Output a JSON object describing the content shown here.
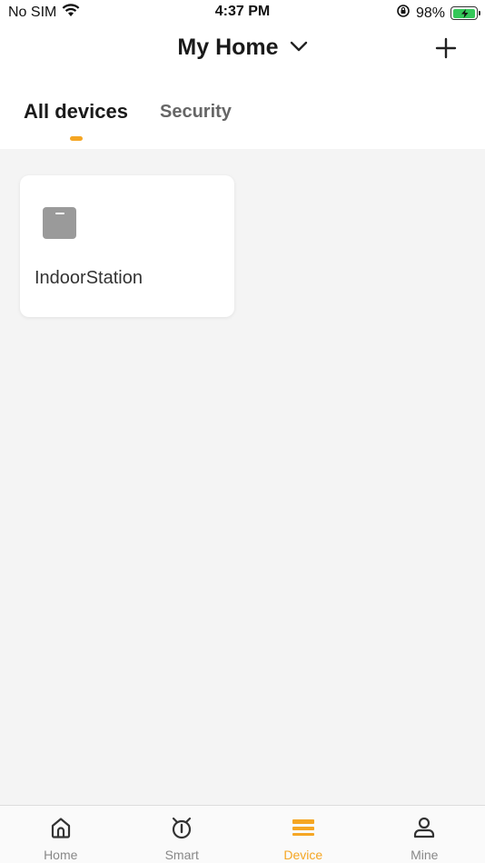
{
  "status_bar": {
    "carrier": "No SIM",
    "time": "4:37 PM",
    "battery_percent": "98%",
    "battery_level": 0.98
  },
  "header": {
    "home_name": "My Home"
  },
  "tabs": [
    {
      "label": "All devices",
      "active": true
    },
    {
      "label": "Security",
      "active": false
    }
  ],
  "devices": [
    {
      "name": "IndoorStation",
      "icon": "indoor-station-icon"
    }
  ],
  "bottom_nav": [
    {
      "label": "Home",
      "icon": "home-icon",
      "active": false
    },
    {
      "label": "Smart",
      "icon": "smart-icon",
      "active": false
    },
    {
      "label": "Device",
      "icon": "device-icon",
      "active": true
    },
    {
      "label": "Mine",
      "icon": "person-icon",
      "active": false
    }
  ],
  "colors": {
    "accent": "#f5a623",
    "battery": "#34c759",
    "inactive_label": "#888888"
  }
}
